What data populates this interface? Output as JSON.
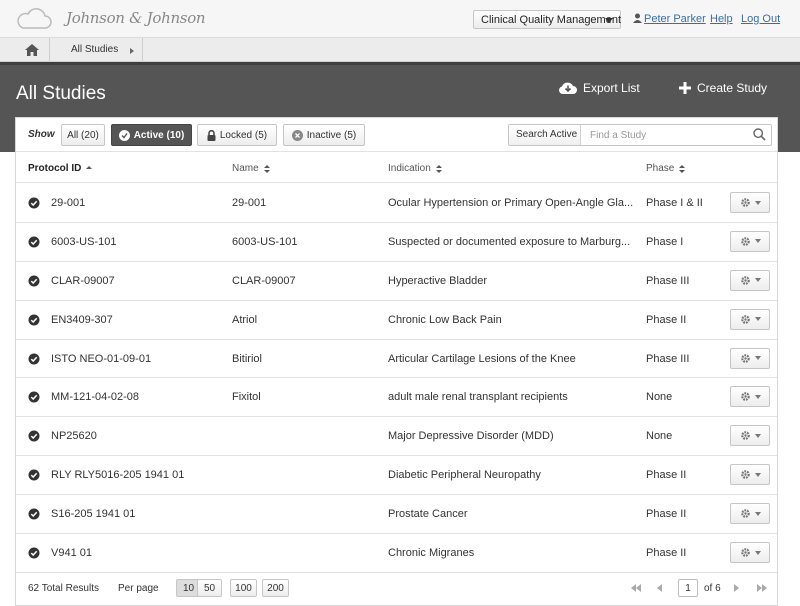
{
  "topbar": {
    "brand": "Johnson & Johnson",
    "app_select": "Clinical Quality Management",
    "user": "Peter Parker",
    "help": "Help",
    "logout": "Log Out"
  },
  "breadcrumb": {
    "item": "All Studies"
  },
  "header": {
    "title": "All Studies",
    "export_label": "Export List",
    "create_label": "Create Study"
  },
  "filters": {
    "show_label": "Show",
    "all": "All (20)",
    "active": "Active (10)",
    "locked": "Locked (5)",
    "inactive": "Inactive (5)"
  },
  "search": {
    "scope": "Search Active",
    "placeholder": "Find a Study"
  },
  "table": {
    "columns": [
      "Protocol ID",
      "Name",
      "Indication",
      "Phase"
    ],
    "rows": [
      {
        "id": "29-001",
        "name": "29-001",
        "indication": "Ocular Hypertension or Primary Open-Angle Gla...",
        "phase": "Phase I & II"
      },
      {
        "id": "6003-US-101",
        "name": "6003-US-101",
        "indication": "Suspected or documented exposure to Marburg...",
        "phase": "Phase I"
      },
      {
        "id": "CLAR-09007",
        "name": "CLAR-09007",
        "indication": "Hyperactive Bladder",
        "phase": "Phase III"
      },
      {
        "id": "EN3409-307",
        "name": "Atriol",
        "indication": "Chronic Low Back Pain",
        "phase": "Phase II"
      },
      {
        "id": "ISTO NEO-01-09-01",
        "name": "Bitiriol",
        "indication": "Articular Cartilage Lesions of the Knee",
        "phase": "Phase III"
      },
      {
        "id": "MM-121-04-02-08",
        "name": "Fixitol",
        "indication": "adult male renal transplant recipients",
        "phase": "None"
      },
      {
        "id": "NP25620",
        "name": "",
        "indication": "Major Depressive Disorder (MDD)",
        "phase": "None"
      },
      {
        "id": "RLY RLY5016-205 1941 01",
        "name": "",
        "indication": "Diabetic Peripheral Neuropathy",
        "phase": "Phase II"
      },
      {
        "id": "S16-205 1941 01",
        "name": "",
        "indication": "Prostate Cancer",
        "phase": "Phase II"
      },
      {
        "id": "V941 01",
        "name": "",
        "indication": "Chronic Migranes",
        "phase": "Phase II"
      }
    ]
  },
  "footer": {
    "total": "62 Total Results",
    "per_page_label": "Per page",
    "per_page_options": [
      "10",
      "50",
      "100",
      "200"
    ],
    "selected_per_page": "10",
    "current_page": "1",
    "of_pages": "of 6"
  }
}
